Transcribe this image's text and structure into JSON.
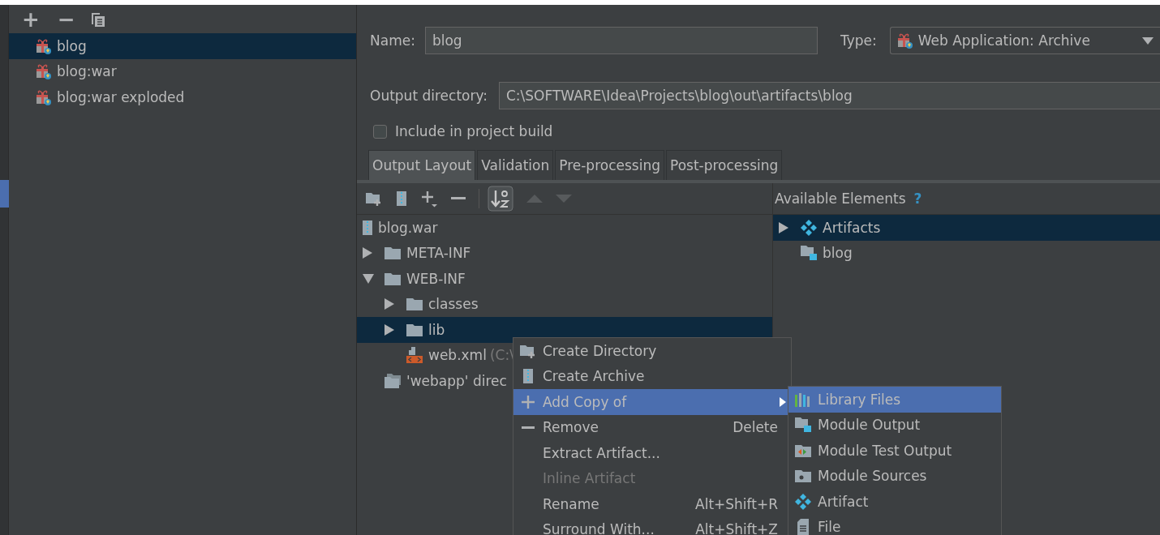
{
  "artifacts_toolbar": [
    "+",
    "−"
  ],
  "artifacts": [
    {
      "name": "blog",
      "selected": true
    },
    {
      "name": "blog:war",
      "selected": false
    },
    {
      "name": "blog:war exploded",
      "selected": false
    }
  ],
  "name_label": "Name:",
  "name_value": "blog",
  "type_label": "Type:",
  "type_value": "Web Application: Archive",
  "output_label": "Output directory:",
  "output_value": "C:\\SOFTWARE\\Idea\\Projects\\blog\\out\\artifacts\\blog",
  "include_build": {
    "label": "Include in project build",
    "checked": false
  },
  "tabs": [
    {
      "label": "Output Layout",
      "selected": true
    },
    {
      "label": "Validation",
      "selected": false
    },
    {
      "label": "Pre-processing",
      "selected": false
    },
    {
      "label": "Post-processing",
      "selected": false
    }
  ],
  "layout_tree": [
    {
      "name": "blog.war",
      "kind": "archive",
      "children": [
        {
          "name": "META-INF",
          "kind": "folder",
          "expanded": false,
          "selected": false
        },
        {
          "name": "WEB-INF",
          "kind": "folder",
          "expanded": true,
          "selected": false,
          "children": [
            {
              "name": "classes",
              "kind": "folder",
              "expanded": false,
              "selected": false
            },
            {
              "name": "lib",
              "kind": "folder",
              "expanded": false,
              "selected": true
            },
            {
              "name": "web.xml",
              "kind": "xml",
              "note": "(C:\\"
            }
          ]
        },
        {
          "name": "'webapp' direc",
          "kind": "folder-group"
        }
      ]
    }
  ],
  "available_title": "Available Elements",
  "available_help": "?",
  "available": [
    {
      "name": "Artifacts",
      "kind": "artifact",
      "expanded": false,
      "selected": true
    },
    {
      "name": "blog",
      "kind": "module",
      "selected": false
    }
  ],
  "context_menu": [
    {
      "label": "Create Directory",
      "kind": "directory",
      "selected": false,
      "disabled": false
    },
    {
      "label": "Create Archive",
      "kind": "archive",
      "selected": false,
      "disabled": false
    },
    {
      "label": "Add Copy of",
      "kind": "add",
      "selected": true,
      "disabled": false,
      "submenu": true
    },
    {
      "label": "Remove",
      "kind": "remove",
      "shortcut": "Delete",
      "selected": false,
      "disabled": false
    },
    {
      "label": "Extract Artifact...",
      "kind": "plain",
      "selected": false,
      "disabled": false
    },
    {
      "label": "Inline Artifact",
      "kind": "plain",
      "selected": false,
      "disabled": true
    },
    {
      "label": "Rename",
      "kind": "plain",
      "shortcut": "Alt+Shift+R",
      "selected": false,
      "disabled": false
    },
    {
      "label": "Surround With...",
      "kind": "plain",
      "shortcut": "Alt+Shift+Z",
      "selected": false,
      "disabled": false
    }
  ],
  "submenu": [
    {
      "label": "Library Files",
      "kind": "library",
      "selected": true
    },
    {
      "label": "Module Output",
      "kind": "module",
      "selected": false
    },
    {
      "label": "Module Test Output",
      "kind": "test",
      "selected": false
    },
    {
      "label": "Module Sources",
      "kind": "sources",
      "selected": false
    },
    {
      "label": "Artifact",
      "kind": "artifact",
      "selected": false
    },
    {
      "label": "File",
      "kind": "file",
      "selected": false
    }
  ]
}
